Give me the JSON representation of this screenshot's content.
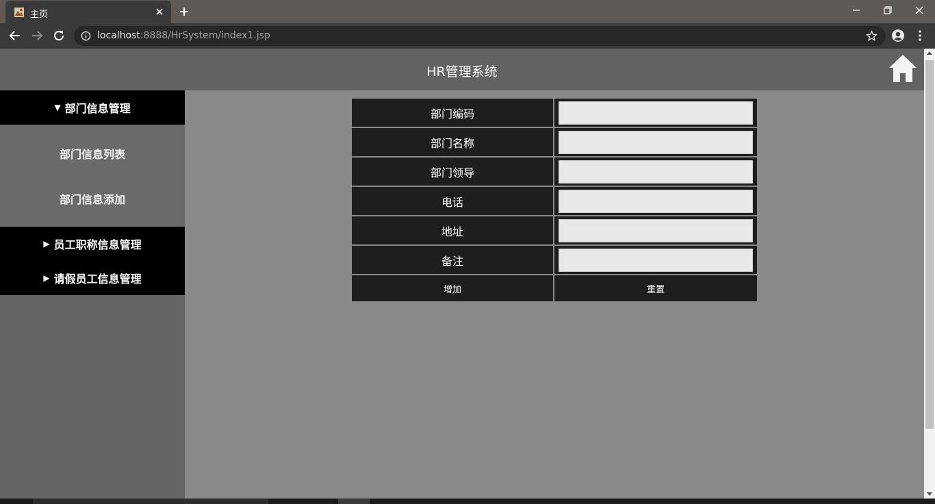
{
  "browser": {
    "tab_title": "主页",
    "url_host": "localhost",
    "url_rest": ":8888/HrSystem/index1.jsp"
  },
  "header": {
    "title": "HR管理系统"
  },
  "sidebar": {
    "groups": [
      {
        "label": "部门信息管理",
        "arrow": "▼",
        "items": [
          "部门信息列表",
          "部门信息添加"
        ]
      },
      {
        "label": "员工职称信息管理",
        "arrow": "▶"
      },
      {
        "label": "请假员工信息管理",
        "arrow": "▶"
      }
    ]
  },
  "form": {
    "fields": [
      {
        "label": "部门编码",
        "value": ""
      },
      {
        "label": "部门名称",
        "value": ""
      },
      {
        "label": "部门领导",
        "value": ""
      },
      {
        "label": "电话",
        "value": ""
      },
      {
        "label": "地址",
        "value": ""
      },
      {
        "label": "备注",
        "value": ""
      }
    ],
    "submit_label": "增加",
    "reset_label": "重置"
  },
  "colors": {
    "header_bg": "#626262",
    "sidebar_bg": "#656565",
    "menu_head_bg": "#000000",
    "content_bg": "#898989",
    "cell_bg": "#1e1e1e",
    "input_bg": "#e8e8e8"
  },
  "icons": [
    "home-icon",
    "back-icon",
    "forward-icon",
    "reload-icon",
    "info-icon",
    "star-icon",
    "account-icon",
    "menu-icon",
    "close-icon",
    "plus-icon"
  ]
}
